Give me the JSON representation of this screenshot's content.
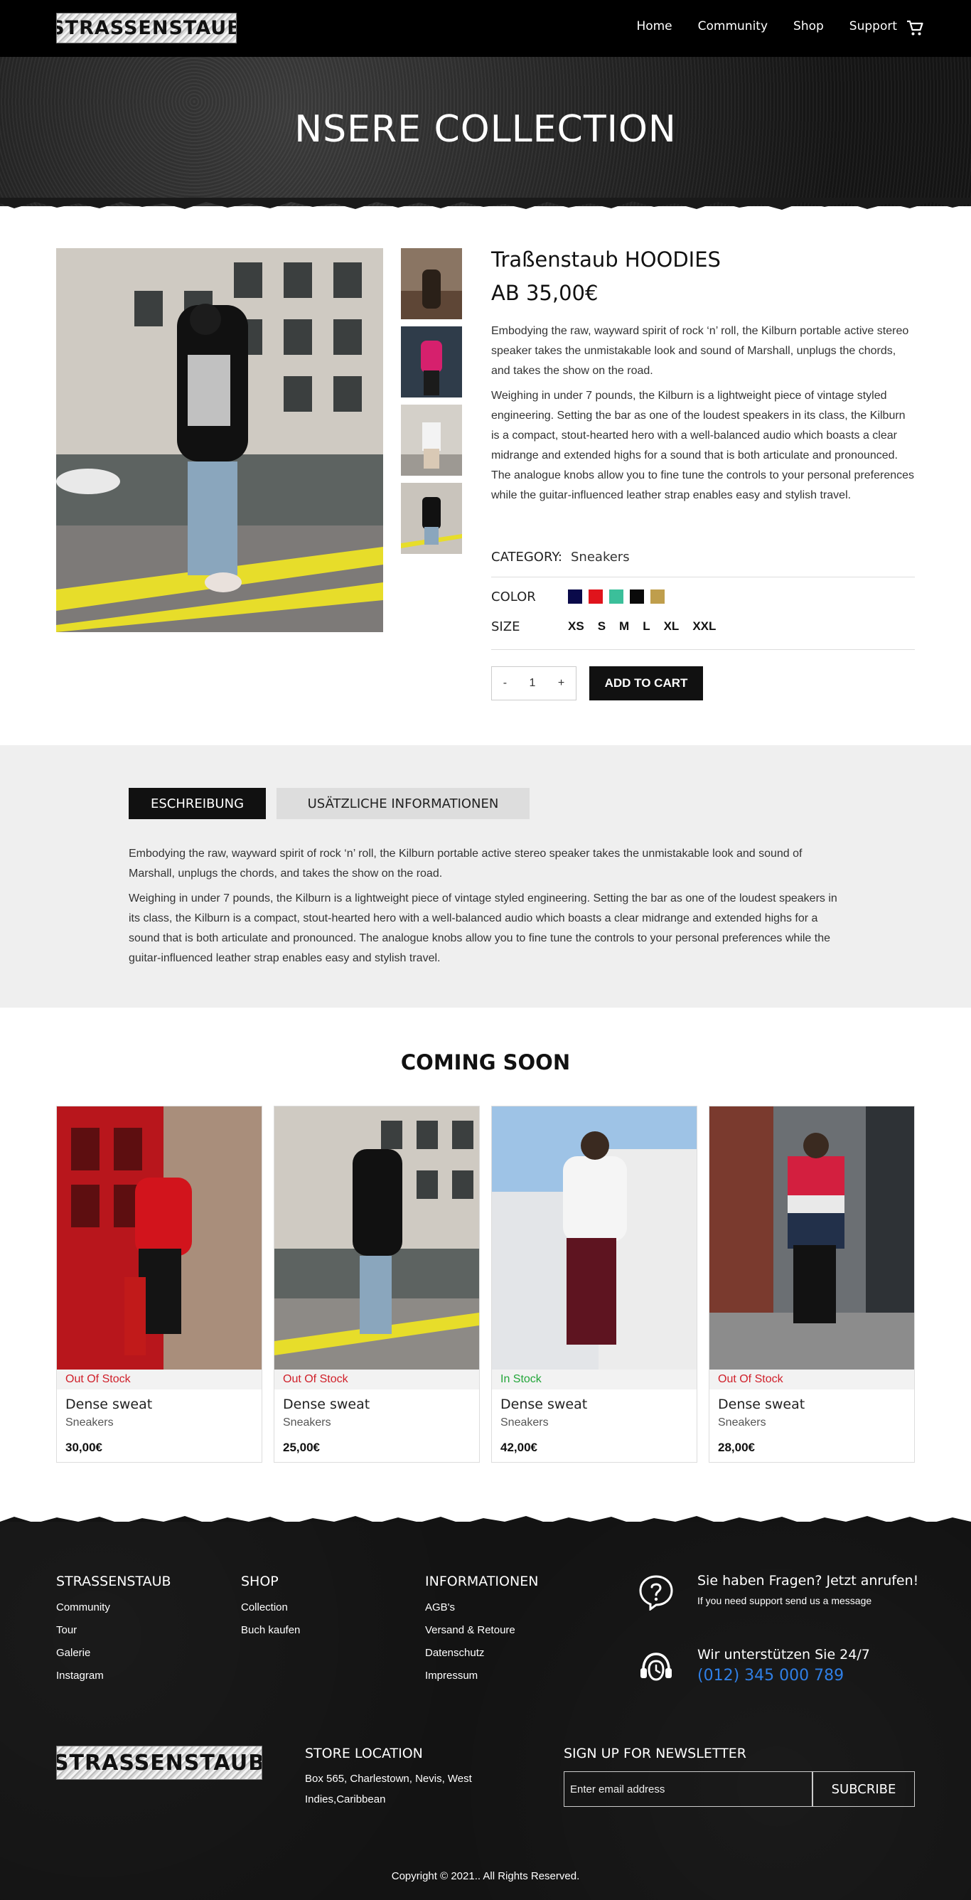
{
  "header": {
    "logo_text": "STRASSENSTAUB",
    "nav": [
      "Home",
      "Community",
      "Shop",
      "Support"
    ],
    "cart_icon": "cart-icon"
  },
  "hero": {
    "title": "NSERE COLLECTION"
  },
  "product": {
    "title": "Traßenstaub HOODIES",
    "price": "AB 35,00€",
    "desc1": "Embodying the raw, wayward spirit of rock ‘n’ roll, the Kilburn portable active stereo speaker takes the unmistakable look and sound of Marshall, unplugs the chords, and takes the show on the road.",
    "desc2": "Weighing in under 7 pounds, the Kilburn is a lightweight piece of vintage styled engineering. Setting the bar as one of the loudest speakers in its class, the Kilburn is a compact, stout-hearted hero with a well-balanced audio which boasts a clear midrange and extended highs for a sound that is both articulate and pronounced. The analogue knobs allow you to fine tune the controls to your personal preferences while the guitar-influenced leather strap enables easy and stylish travel.",
    "category_label": "CATEGORY:",
    "category_value": "Sneakers",
    "color_label": "COLOR",
    "colors": [
      "#0a0a4a",
      "#e0141c",
      "#3bbf9a",
      "#0a0a0a",
      "#bf9e4c"
    ],
    "size_label": "SIZE",
    "sizes": [
      "XS",
      "S",
      "M",
      "L",
      "XL",
      "XXL"
    ],
    "qty_minus": "-",
    "qty_value": "1",
    "qty_plus": "+",
    "add_to_cart": "ADD TO CART"
  },
  "tabs": {
    "active": "ESCHREIBUNG",
    "inactive": "USÄTZLICHE INFORMATIONEN",
    "desc1": "Embodying the raw, wayward spirit of rock ‘n’ roll, the Kilburn portable active stereo speaker takes the unmistakable look and sound of Marshall, unplugs the chords, and takes the show on the road.",
    "desc2": "Weighing in under 7 pounds, the Kilburn is a lightweight piece of vintage styled engineering. Setting the bar as one of the loudest speakers in its class, the Kilburn is a compact, stout-hearted hero with a well-balanced audio which boasts a clear midrange and extended highs for a sound that is both articulate and pronounced. The analogue knobs allow you to fine tune the controls to your personal preferences while the guitar-influenced leather strap enables easy and stylish travel."
  },
  "coming_soon": {
    "title": "COMING SOON",
    "cards": [
      {
        "stock": "Out Of Stock",
        "stock_color": "#d0202a",
        "name": "Dense sweat",
        "category": "Sneakers",
        "price": "30,00€"
      },
      {
        "stock": "Out Of Stock",
        "stock_color": "#d0202a",
        "name": "Dense sweat",
        "category": "Sneakers",
        "price": "25,00€"
      },
      {
        "stock": "In Stock",
        "stock_color": "#23a63a",
        "name": "Dense sweat",
        "category": "Sneakers",
        "price": "42,00€"
      },
      {
        "stock": "Out Of Stock",
        "stock_color": "#d0202a",
        "name": "Dense sweat",
        "category": "Sneakers",
        "price": "28,00€"
      }
    ]
  },
  "footer": {
    "col1": {
      "title": "STRASSENSTAUB",
      "links": [
        "Community",
        "Tour",
        "Galerie",
        "Instagram"
      ]
    },
    "col2": {
      "title": "SHOP",
      "links": [
        "Collection",
        "Buch kaufen"
      ]
    },
    "col3": {
      "title": "INFORMATIONEN",
      "links": [
        "AGB's",
        "Versand & Retoure",
        "Datenschutz",
        "Impressum"
      ]
    },
    "help_title": "Sie haben Fragen? Jetzt anrufen!",
    "help_sub": "If you need support send us a message",
    "support_title": "Wir unterstützen Sie 24/7",
    "phone": "(012) 345 000 789",
    "logo_text": "STRASSENSTAUB",
    "store_title": "STORE LOCATION",
    "store_line1": "Box 565, Charlestown, Nevis, West",
    "store_line2": "Indies,Caribbean",
    "newsletter_title": "SIGN UP FOR NEWSLETTER",
    "newsletter_placeholder": "Enter email address",
    "subscribe": "SUBCRIBE",
    "copyright": "Copyright © 2021.. All Rights Reserved."
  }
}
